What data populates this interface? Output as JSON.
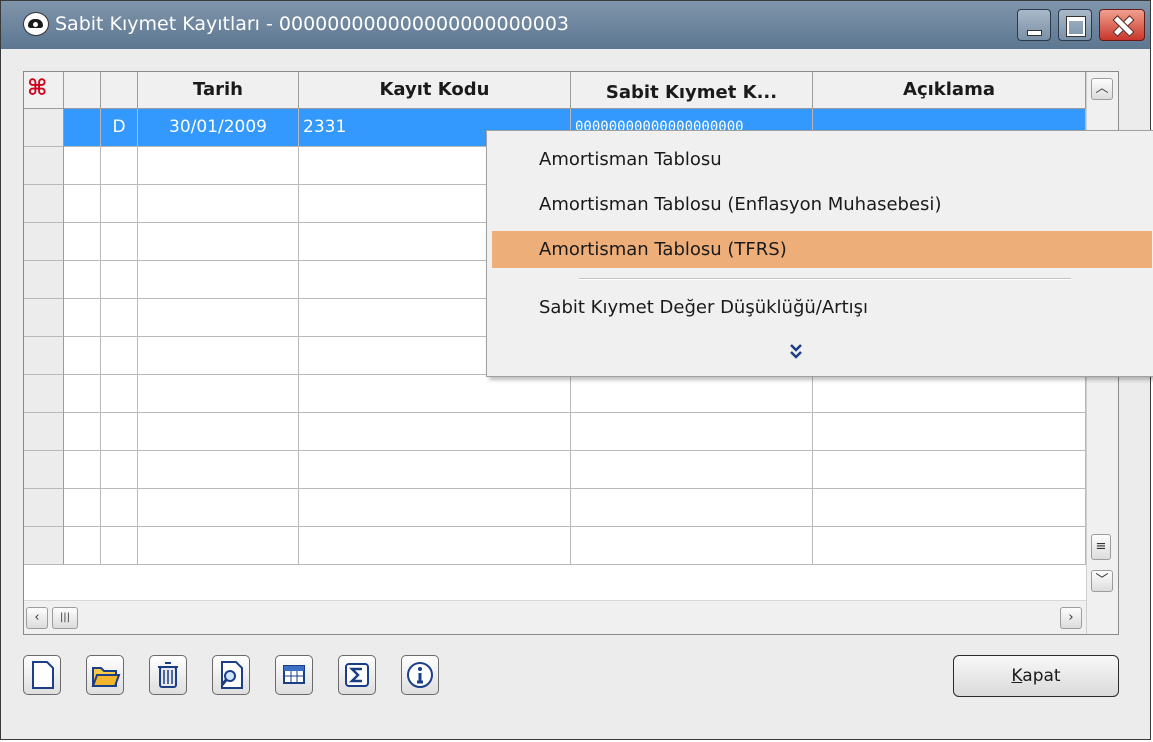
{
  "window": {
    "title": "Sabit Kıymet Kayıtları - 000000000000000000000003"
  },
  "grid": {
    "columns": [
      "",
      "",
      "Tarih",
      "Kayıt Kodu",
      "Sabit Kıymet K...",
      "Açıklama"
    ],
    "rows": [
      {
        "type": "D",
        "tarih": "30/01/2009",
        "kayit_kodu": "2331",
        "sabit_kiymet_kodu": "00000000000000000000",
        "aciklama": ""
      }
    ]
  },
  "context_menu": {
    "items": [
      "Amortisman Tablosu",
      "Amortisman Tablosu (Enflasyon Muhasebesi)",
      "Amortisman Tablosu (TFRS)",
      "Sabit Kıymet Değer Düşüklüğü/Artışı"
    ],
    "highlighted_index": 2,
    "more_icon": "double-chevron-down-icon"
  },
  "toolbar": {
    "buttons": [
      "new-document-icon",
      "open-folder-icon",
      "trash-icon",
      "preview-icon",
      "grid-view-icon",
      "sigma-icon",
      "info-icon"
    ],
    "close_prefix": "K",
    "close_rest": "apat"
  },
  "colors": {
    "title_bar": "#6f87a0",
    "selected_row": "#3399ff",
    "menu_highlight": "#edae7a",
    "close_button": "#c9362b"
  }
}
